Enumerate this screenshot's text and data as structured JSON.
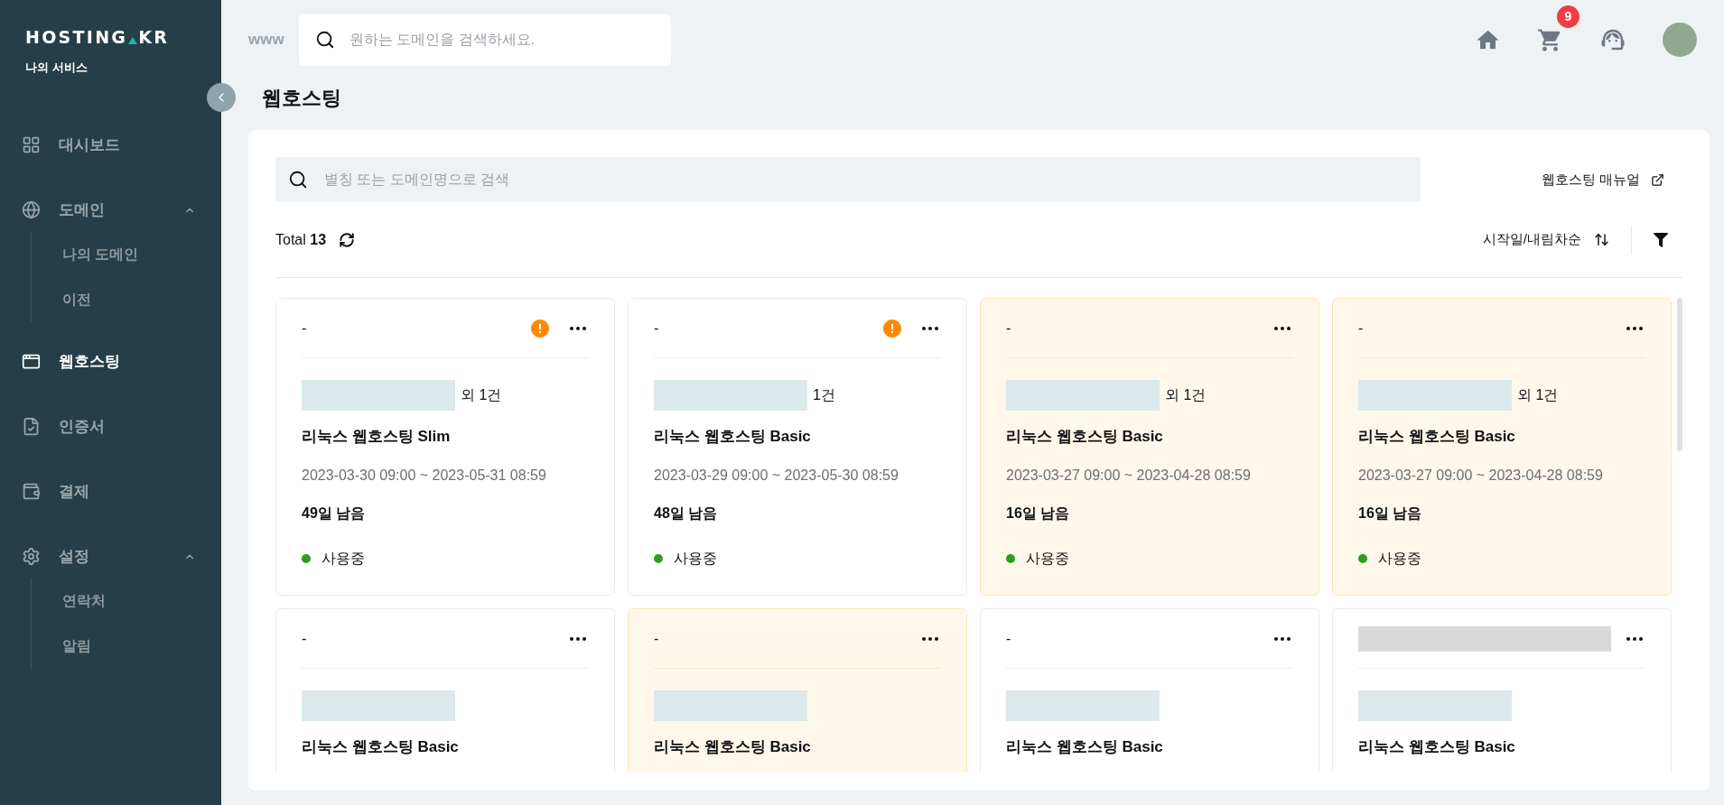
{
  "sidebar": {
    "logo": [
      "HOSTING",
      "KR"
    ],
    "subtitle": "나의 서비스",
    "items": [
      {
        "label": "대시보드",
        "selected": false
      },
      {
        "label": "도메인",
        "selected": false,
        "expanded": true,
        "children": [
          {
            "label": "나의 도메인",
            "selected": false
          },
          {
            "label": "이전",
            "selected": false
          }
        ]
      },
      {
        "label": "웹호스팅",
        "selected": true
      },
      {
        "label": "인증서",
        "selected": false
      },
      {
        "label": "결제",
        "selected": false
      },
      {
        "label": "설정",
        "selected": false,
        "expanded": true,
        "children": [
          {
            "label": "연락처",
            "selected": false
          },
          {
            "label": "알림",
            "selected": false
          }
        ]
      }
    ]
  },
  "header": {
    "prefix": "www",
    "search": {
      "placeholder": "원하는 도메인을 검색하세요."
    },
    "cart_count": "9"
  },
  "page_title": "웹호스팅",
  "panel": {
    "search": {
      "placeholder": "별칭 또는 도메인명으로 검색"
    },
    "manual_link": "웹호스팅 매뉴얼",
    "total": "Total **13**",
    "sort_label": "시작일/내림차순"
  },
  "cards": [
    {
      "title": "-",
      "title_redacted": false,
      "warning": true,
      "highlighted": false,
      "domain_suffix": "외 1건",
      "product": "리눅스 웹호스팅 Slim",
      "period": "2023-03-30 09:00 ~ 2023-05-31 08:59",
      "remaining": "49일 남음",
      "status": "사용중",
      "color": "#2e9e1f"
    },
    {
      "title": "-",
      "title_redacted": false,
      "warning": true,
      "highlighted": false,
      "domain_suffix": "1건",
      "product": "리눅스 웹호스팅 Basic",
      "period": "2023-03-29 09:00 ~ 2023-05-30 08:59",
      "remaining": "48일 남음",
      "status": "사용중",
      "color": "#2e9e1f"
    },
    {
      "title": "-",
      "title_redacted": false,
      "warning": false,
      "highlighted": true,
      "domain_suffix": "외 1건",
      "product": "리눅스 웹호스팅 Basic",
      "period": "2023-03-27 09:00 ~ 2023-04-28 08:59",
      "remaining": "16일 남음",
      "status": "사용중",
      "color": "#2e9e1f"
    },
    {
      "title": "-",
      "title_redacted": false,
      "warning": false,
      "highlighted": true,
      "domain_suffix": "외 1건",
      "product": "리눅스 웹호스팅 Basic",
      "period": "2023-03-27 09:00 ~ 2023-04-28 08:59",
      "remaining": "16일 남음",
      "status": "사용중",
      "color": "#2e9e1f"
    },
    {
      "title": "-",
      "title_redacted": false,
      "warning": false,
      "highlighted": false,
      "product": "리눅스 웹호스팅 Basic"
    },
    {
      "title": "-",
      "title_redacted": false,
      "warning": false,
      "highlighted": true,
      "product": "리눅스 웹호스팅 Basic"
    },
    {
      "title": "-",
      "title_redacted": false,
      "warning": false,
      "highlighted": false,
      "product": "리눅스 웹호스팅 Basic"
    },
    {
      "title_redacted": true,
      "warning": false,
      "highlighted": false,
      "product": "리눅스 웹호스팅 Basic"
    }
  ]
}
